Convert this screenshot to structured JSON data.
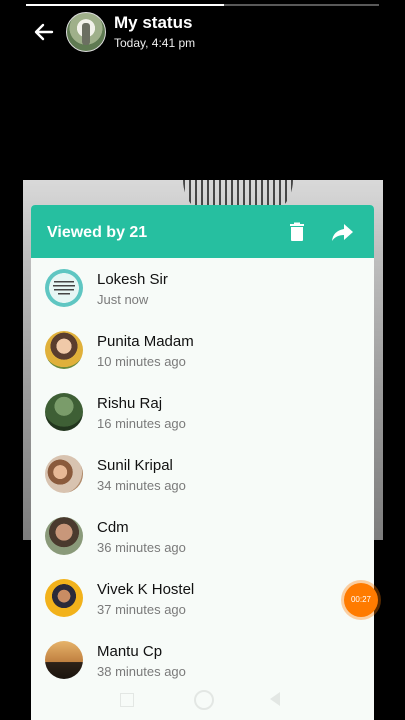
{
  "progress": {
    "fraction": 0.56
  },
  "header": {
    "title": "My status",
    "subtitle": "Today, 4:41 pm",
    "back_icon": "arrow-left-icon"
  },
  "panel": {
    "title": "Viewed by 21",
    "delete_icon": "trash-icon",
    "forward_icon": "share-forward-icon",
    "accent_color": "#26bfa0"
  },
  "viewers": [
    {
      "name": "Lokesh Sir",
      "time": "Just now"
    },
    {
      "name": "Punita Madam",
      "time": "10 minutes ago"
    },
    {
      "name": "Rishu Raj",
      "time": "16 minutes ago"
    },
    {
      "name": "Sunil Kripal",
      "time": "34 minutes ago"
    },
    {
      "name": "Cdm",
      "time": "36 minutes ago"
    },
    {
      "name": "Vivek K Hostel",
      "time": "37 minutes ago"
    },
    {
      "name": "Mantu Cp",
      "time": "38 minutes ago"
    }
  ],
  "timer": {
    "label": "00:27",
    "color": "#ff7b00"
  }
}
